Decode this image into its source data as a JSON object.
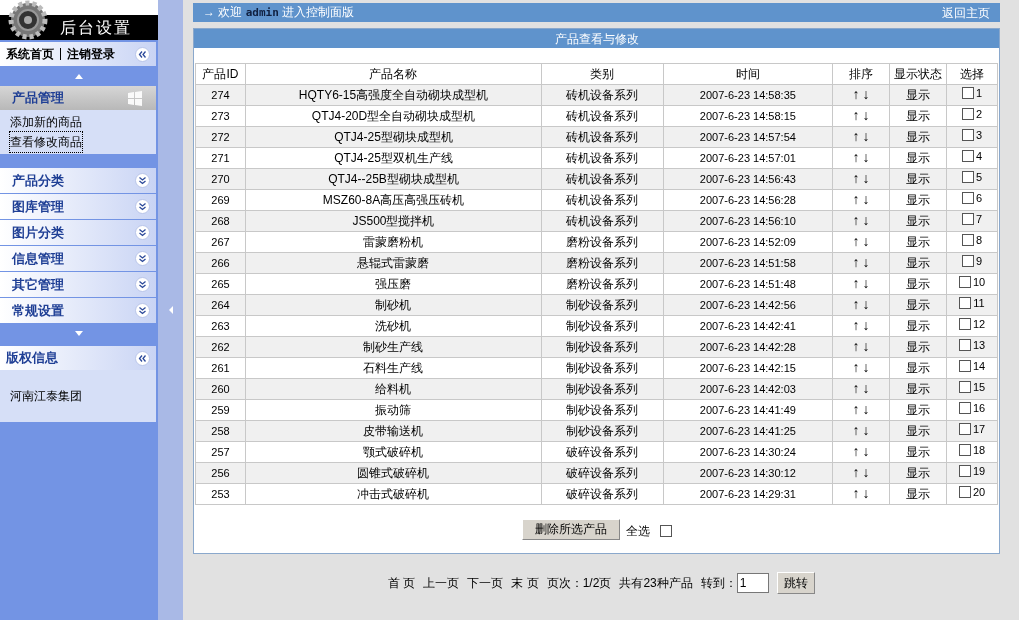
{
  "sidebar": {
    "logo_title": "后台设置",
    "top_links": [
      {
        "label": "系统首页"
      },
      {
        "label": "注销登录"
      }
    ],
    "menus": [
      {
        "title": "产品管理",
        "expanded": true,
        "items": [
          {
            "label": "添加新的商品",
            "selected": false
          },
          {
            "label": "查看修改商品",
            "selected": true
          }
        ]
      },
      {
        "title": "产品分类",
        "expanded": false
      },
      {
        "title": "图库管理",
        "expanded": false
      },
      {
        "title": "图片分类",
        "expanded": false
      },
      {
        "title": "信息管理",
        "expanded": false
      },
      {
        "title": "其它管理",
        "expanded": false
      },
      {
        "title": "常规设置",
        "expanded": false
      }
    ],
    "copyright": {
      "title": "版权信息",
      "text": "河南江泰集团"
    }
  },
  "top_bar": {
    "arrow": "→",
    "welcome": "欢迎",
    "user": "admin",
    "suffix": "进入控制面版",
    "home_link": "返回主页"
  },
  "panel": {
    "title": "产品查看与修改"
  },
  "table": {
    "columns": [
      "产品ID",
      "产品名称",
      "类别",
      "时间",
      "排序",
      "显示状态",
      "选择"
    ],
    "rows": [
      {
        "id": "274",
        "name": "HQTY6-15高强度全自动砌块成型机",
        "category": "砖机设备系列",
        "time": "2007-6-23 14:58:35",
        "up": "↑",
        "down": "↓",
        "status": "显示",
        "checked": false,
        "number": "1"
      },
      {
        "id": "273",
        "name": "QTJ4-20D型全自动砌块成型机",
        "category": "砖机设备系列",
        "time": "2007-6-23 14:58:15",
        "up": "↑",
        "down": "↓",
        "status": "显示",
        "checked": false,
        "number": "2"
      },
      {
        "id": "272",
        "name": "QTJ4-25型砌块成型机",
        "category": "砖机设备系列",
        "time": "2007-6-23 14:57:54",
        "up": "↑",
        "down": "↓",
        "status": "显示",
        "checked": false,
        "number": "3"
      },
      {
        "id": "271",
        "name": "QTJ4-25型双机生产线",
        "category": "砖机设备系列",
        "time": "2007-6-23 14:57:01",
        "up": "↑",
        "down": "↓",
        "status": "显示",
        "checked": false,
        "number": "4"
      },
      {
        "id": "270",
        "name": "QTJ4--25B型砌块成型机",
        "category": "砖机设备系列",
        "time": "2007-6-23 14:56:43",
        "up": "↑",
        "down": "↓",
        "status": "显示",
        "checked": false,
        "number": "5"
      },
      {
        "id": "269",
        "name": "MSZ60-8A高压高强压砖机",
        "category": "砖机设备系列",
        "time": "2007-6-23 14:56:28",
        "up": "↑",
        "down": "↓",
        "status": "显示",
        "checked": false,
        "number": "6"
      },
      {
        "id": "268",
        "name": "JS500型搅拌机",
        "category": "砖机设备系列",
        "time": "2007-6-23 14:56:10",
        "up": "↑",
        "down": "↓",
        "status": "显示",
        "checked": false,
        "number": "7"
      },
      {
        "id": "267",
        "name": "雷蒙磨粉机",
        "category": "磨粉设备系列",
        "time": "2007-6-23 14:52:09",
        "up": "↑",
        "down": "↓",
        "status": "显示",
        "checked": false,
        "number": "8"
      },
      {
        "id": "266",
        "name": "悬辊式雷蒙磨",
        "category": "磨粉设备系列",
        "time": "2007-6-23 14:51:58",
        "up": "↑",
        "down": "↓",
        "status": "显示",
        "checked": false,
        "number": "9"
      },
      {
        "id": "265",
        "name": "强压磨",
        "category": "磨粉设备系列",
        "time": "2007-6-23 14:51:48",
        "up": "↑",
        "down": "↓",
        "status": "显示",
        "checked": false,
        "number": "10"
      },
      {
        "id": "264",
        "name": "制砂机",
        "category": "制砂设备系列",
        "time": "2007-6-23 14:42:56",
        "up": "↑",
        "down": "↓",
        "status": "显示",
        "checked": false,
        "number": "11"
      },
      {
        "id": "263",
        "name": "洗砂机",
        "category": "制砂设备系列",
        "time": "2007-6-23 14:42:41",
        "up": "↑",
        "down": "↓",
        "status": "显示",
        "checked": false,
        "number": "12"
      },
      {
        "id": "262",
        "name": "制砂生产线",
        "category": "制砂设备系列",
        "time": "2007-6-23 14:42:28",
        "up": "↑",
        "down": "↓",
        "status": "显示",
        "checked": false,
        "number": "13"
      },
      {
        "id": "261",
        "name": "石料生产线",
        "category": "制砂设备系列",
        "time": "2007-6-23 14:42:15",
        "up": "↑",
        "down": "↓",
        "status": "显示",
        "checked": false,
        "number": "14"
      },
      {
        "id": "260",
        "name": "给料机",
        "category": "制砂设备系列",
        "time": "2007-6-23 14:42:03",
        "up": "↑",
        "down": "↓",
        "status": "显示",
        "checked": false,
        "number": "15"
      },
      {
        "id": "259",
        "name": "振动筛",
        "category": "制砂设备系列",
        "time": "2007-6-23 14:41:49",
        "up": "↑",
        "down": "↓",
        "status": "显示",
        "checked": false,
        "number": "16"
      },
      {
        "id": "258",
        "name": "皮带输送机",
        "category": "制砂设备系列",
        "time": "2007-6-23 14:41:25",
        "up": "↑",
        "down": "↓",
        "status": "显示",
        "checked": false,
        "number": "17"
      },
      {
        "id": "257",
        "name": "颚式破碎机",
        "category": "破碎设备系列",
        "time": "2007-6-23 14:30:24",
        "up": "↑",
        "down": "↓",
        "status": "显示",
        "checked": false,
        "number": "18"
      },
      {
        "id": "256",
        "name": "圆锥式破碎机",
        "category": "破碎设备系列",
        "time": "2007-6-23 14:30:12",
        "up": "↑",
        "down": "↓",
        "status": "显示",
        "checked": false,
        "number": "19"
      },
      {
        "id": "253",
        "name": "冲击式破碎机",
        "category": "破碎设备系列",
        "time": "2007-6-23 14:29:31",
        "up": "↑",
        "down": "↓",
        "status": "显示",
        "checked": false,
        "number": "20"
      }
    ]
  },
  "actions": {
    "delete_button": "删除所选产品",
    "select_all": {
      "label": "全选",
      "checked": false
    }
  },
  "pagination": {
    "first": "首 页",
    "prev": "上一页",
    "next": "下一页",
    "last": "末 页",
    "page_info": "页次：1/2页",
    "total": "共有23种产品",
    "goto_label": "转到：",
    "goto_value": "1",
    "goto_button": "跳转"
  }
}
